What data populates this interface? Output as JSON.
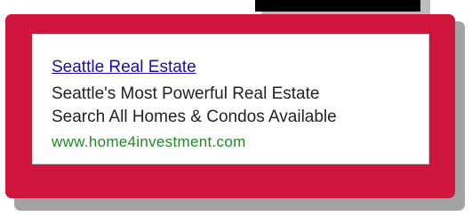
{
  "ad": {
    "title": "Seattle Real Estate",
    "description_line1": "Seattle's Most Powerful Real Estate",
    "description_line2": "Search All Homes & Condos Available",
    "display_url": "www.home4investment.com"
  },
  "colors": {
    "frame": "#d0163d",
    "title_link": "#1a0dab",
    "url": "#1e8a22",
    "text": "#222222"
  }
}
